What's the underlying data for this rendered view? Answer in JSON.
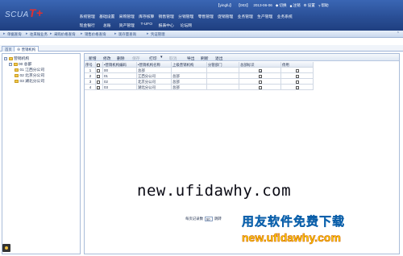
{
  "app": {
    "logo_text": "SCUA",
    "logo_mark": "T+"
  },
  "user_bar": {
    "user": "【yingfu】",
    "org": "【003】",
    "date": "2013-06-06",
    "tools": [
      "切换",
      "注销",
      "设置",
      "帮助"
    ]
  },
  "menu": {
    "row1": [
      "系统管理",
      "基础设置",
      "采购管理",
      "库存核算",
      "销售管理",
      "分销管理",
      "零售管理",
      "促销管理",
      "业务管理",
      "生产管理",
      "业务系统"
    ],
    "row2": [
      "现金银行",
      "总账",
      "资产管理",
      "T-UFO",
      "报表中心",
      "论坛网"
    ]
  },
  "subnav": {
    "items": [
      "单据查询",
      "往来账业务",
      "采购价格查询",
      "销售价格查询",
      "现存量查询",
      "凭证管理"
    ]
  },
  "tabs": [
    "首页",
    "营销机构"
  ],
  "tree": {
    "root": "营销机构",
    "child": "00 总部",
    "leaves": [
      "01 江西分公司",
      "02 北京分公司",
      "03 湖北分公司"
    ]
  },
  "toolbar": {
    "buttons": [
      "新增",
      "修改",
      "删除",
      "保存",
      "打印",
      "取消",
      "导出",
      "刷新",
      "退出"
    ],
    "disabled": [
      false,
      false,
      false,
      true,
      false,
      true,
      false,
      false,
      false
    ]
  },
  "grid": {
    "headers": [
      "序号",
      "",
      "•营销机构编码",
      "•营销机构名称",
      "上级营销机构",
      "分管部门",
      "总部标识",
      "停用"
    ],
    "rows": [
      {
        "no": "1",
        "code": "00",
        "name": "总部",
        "parent": "",
        "dept": "",
        "hq": true,
        "disabled": false
      },
      {
        "no": "2",
        "code": "01",
        "name": "江西分公司",
        "parent": "总部",
        "dept": "",
        "hq": false,
        "disabled": false
      },
      {
        "no": "3",
        "code": "02",
        "name": "北京分公司",
        "parent": "总部",
        "dept": "",
        "hq": false,
        "disabled": false
      },
      {
        "no": "4",
        "code": "03",
        "name": "湖北分公司",
        "parent": "总部",
        "dept": "",
        "hq": false,
        "disabled": false
      }
    ]
  },
  "pager": {
    "label": "每页记录数",
    "value": "50",
    "suffix": "跳转"
  },
  "watermarks": {
    "main": "new.ufidawhy.com",
    "cn": "用友软件免费下载",
    "url": "new.ufidawhy.com"
  }
}
